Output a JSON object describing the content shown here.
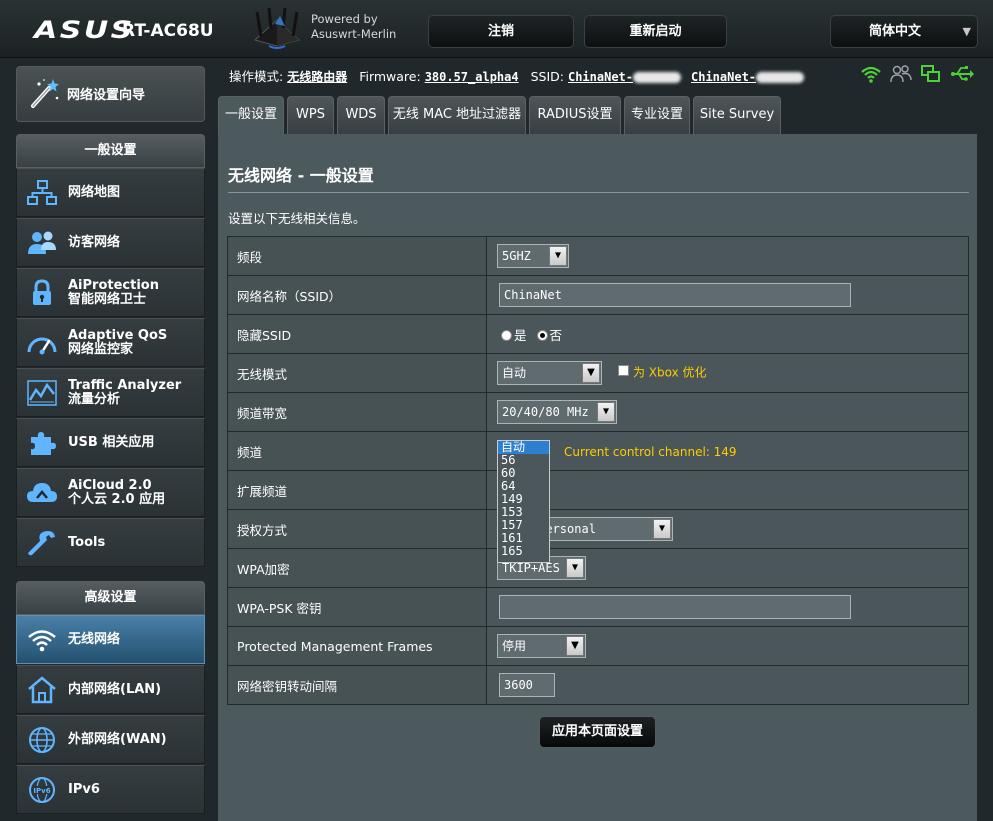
{
  "header": {
    "brand": "ASUS",
    "model": "RT-AC68U",
    "powered_line1": "Powered by",
    "powered_line2": "Asuswrt-Merlin",
    "logout": "注销",
    "reboot": "重新启动",
    "language": "简体中文"
  },
  "sidebar": {
    "wizard": "网络设置向导",
    "general_header": "一般设置",
    "general_items": [
      {
        "label1": "网络地图",
        "label2": "",
        "icon": "network-map-icon"
      },
      {
        "label1": "访客网络",
        "label2": "",
        "icon": "guest-network-icon"
      },
      {
        "label1": "AiProtection",
        "label2": "智能网络卫士",
        "icon": "lock-icon"
      },
      {
        "label1": "Adaptive QoS",
        "label2": "网络监控家",
        "icon": "gauge-icon"
      },
      {
        "label1": "Traffic Analyzer",
        "label2": "流量分析",
        "icon": "traffic-chart-icon"
      },
      {
        "label1": "USB 相关应用",
        "label2": "",
        "icon": "puzzle-icon"
      },
      {
        "label1": "AiCloud 2.0",
        "label2": "个人云 2.0 应用",
        "icon": "cloud-icon"
      },
      {
        "label1": "Tools",
        "label2": "",
        "icon": "wrench-icon"
      }
    ],
    "advanced_header": "高级设置",
    "advanced_items": [
      {
        "label1": "无线网络",
        "icon": "wireless-icon"
      },
      {
        "label1": "内部网络(LAN)",
        "icon": "home-icon"
      },
      {
        "label1": "外部网络(WAN)",
        "icon": "globe-icon"
      },
      {
        "label1": "IPv6",
        "icon": "ipv6-icon"
      }
    ]
  },
  "status": {
    "mode_label": "操作模式:",
    "mode_value": "无线路由器",
    "fw_label": "Firmware:",
    "fw_value": "380.57_alpha4",
    "ssid_label": "SSID:",
    "ssid1": "ChinaNet-",
    "ssid2": "ChinaNet-"
  },
  "tabs": [
    "一般设置",
    "WPS",
    "WDS",
    "无线 MAC 地址过滤器",
    "RADIUS设置",
    "专业设置",
    "Site Survey"
  ],
  "page": {
    "title": "无线网络 - 一般设置",
    "description": "设置以下无线相关信息。",
    "apply": "应用本页面设置"
  },
  "form": {
    "band_label": "频段",
    "band_value": "5GHZ",
    "ssid_label": "网络名称（SSID）",
    "ssid_value": "ChinaNet",
    "hide_label": "隐藏SSID",
    "hide_yes": "是",
    "hide_no": "否",
    "mode_label": "无线模式",
    "mode_value": "自动",
    "xbox_label": "为 Xbox 优化",
    "bw_label": "频道带宽",
    "bw_value": "20/40/80 MHz",
    "channel_label": "频道",
    "channel_hint": "Current control channel: 149",
    "ext_label": "扩展频道",
    "auth_label": "授权方式",
    "auth_value": "WPA2-Personal",
    "wpa_label": "WPA加密",
    "wpa_value": "TKIP+AES",
    "psk_label": "WPA-PSK 密钥",
    "psk_value": "",
    "pmf_label": "Protected Management Frames",
    "pmf_value": "停用",
    "rekey_label": "网络密钥转动间隔",
    "rekey_value": "3600"
  },
  "channel_options": [
    "自动",
    "56",
    "60",
    "64",
    "149",
    "153",
    "157",
    "161",
    "165"
  ],
  "colors": {
    "accent_blue": "#2f7fd1",
    "hint_yellow": "#ffcc00",
    "panel": "#4d5a5d",
    "status_green": "#4cd137"
  }
}
